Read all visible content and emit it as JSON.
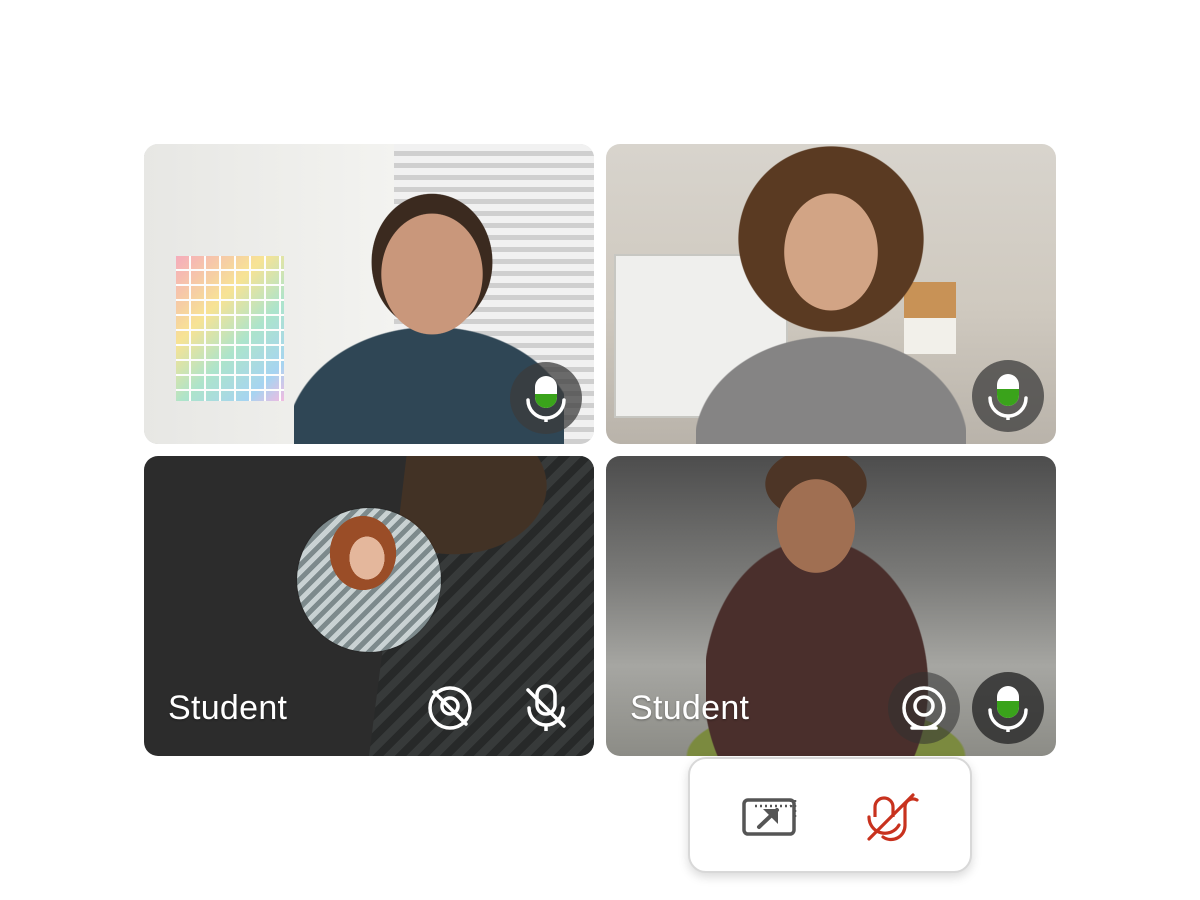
{
  "participants": [
    {
      "name": "",
      "camera": "on",
      "mic": "active"
    },
    {
      "name": "",
      "camera": "on",
      "mic": "active"
    },
    {
      "name": "Student",
      "camera": "off",
      "mic": "muted"
    },
    {
      "name": "Student",
      "camera": "on",
      "mic": "active"
    }
  ],
  "icons": {
    "mic_active": "microphone-icon",
    "mic_muted": "microphone-off-icon",
    "camera_on": "camera-icon",
    "camera_off": "camera-off-icon",
    "share_screen": "share-screen-icon",
    "mute_all": "mute-microphone-icon"
  },
  "colors": {
    "mic_level": "#3aa31b",
    "mute_red": "#c8321e",
    "toolbar_icon": "#555555",
    "tile_dark": "#2c2c2c"
  }
}
